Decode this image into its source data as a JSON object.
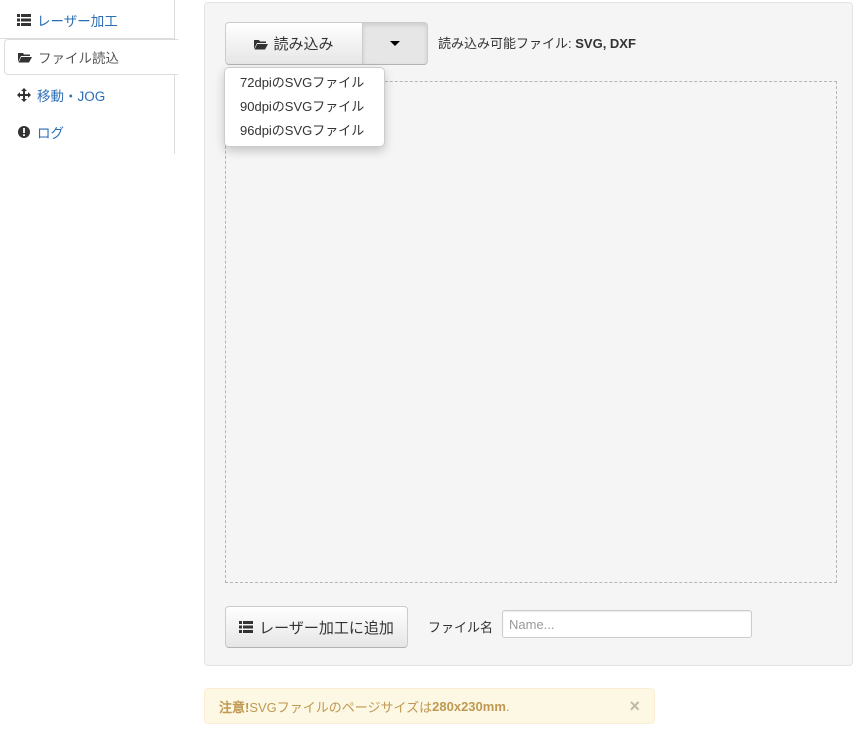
{
  "sidebar": {
    "items": [
      {
        "label": "レーザー加工",
        "icon": "list-icon"
      },
      {
        "label": "ファイル読込",
        "icon": "folder-open-icon",
        "active": true
      },
      {
        "label": "移動・JOG",
        "icon": "move-icon"
      },
      {
        "label": "ログ",
        "icon": "exclamation-circle-icon"
      }
    ]
  },
  "toolbar": {
    "load_label": "読み込み",
    "formats_prefix": "読み込み可能ファイル: ",
    "formats_value": "SVG, DXF"
  },
  "dropdown": {
    "items": [
      "72dpiのSVGファイル",
      "90dpiのSVGファイル",
      "96dpiのSVGファイル"
    ]
  },
  "footer": {
    "add_label": "レーザー加工に追加",
    "filename_label": "ファイル名",
    "filename_placeholder": "Name...",
    "filename_value": ""
  },
  "alert": {
    "strong": "注意!",
    "text": " SVGファイルのページサイズは ",
    "size": "280x230mm",
    "end": ".",
    "close": "×"
  },
  "colors": {
    "link": "#2a6eb5",
    "alert_bg": "#fcf8e3",
    "alert_text": "#c09853"
  }
}
